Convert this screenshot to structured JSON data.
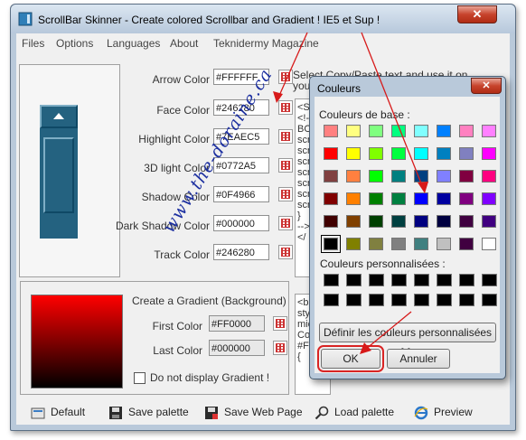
{
  "window": {
    "title": "ScrollBar Skinner - Create colored Scrollbar and Gradient ! IE5 et Sup !",
    "close_label": "✕"
  },
  "menu": [
    "Files",
    "Options",
    "Languages",
    "About",
    "Teknidermy Magazine"
  ],
  "colors": [
    {
      "label": "Arrow Color",
      "value": "#FFFFFF"
    },
    {
      "label": "Face Color",
      "value": "#246280"
    },
    {
      "label": "Highlight Color",
      "value": "#7EAEC5"
    },
    {
      "label": "3D light Color",
      "value": "#0772A5"
    },
    {
      "label": "Shadow Color",
      "value": "#0F4966"
    },
    {
      "label": "Dark Shadow Color",
      "value": "#000000"
    },
    {
      "label": "Track Color",
      "value": "#246280"
    }
  ],
  "info_text": [
    "Select Copy/Paste text and use it on",
    "you"
  ],
  "code_lines": [
    "<S",
    "<!-",
    "BO",
    "scr",
    "scr",
    "scr",
    "scr",
    "scr",
    "scr",
    "scr",
    "}",
    "-->",
    "</"
  ],
  "gradient": {
    "heading": "Create a Gradient (Background)",
    "first_label": "First Color",
    "first_value": "#FF0000",
    "last_label": "Last Color",
    "last_value": "#000000",
    "checkbox_label": "Do not display Gradient !",
    "code_lines": [
      "<bo",
      "sty",
      "mic",
      "Co",
      "#FF",
      "{"
    ]
  },
  "toolbar": {
    "default": "Default",
    "save_palette": "Save palette",
    "save_web": "Save Web Page",
    "load_palette": "Load palette",
    "preview": "Preview"
  },
  "dialog": {
    "title": "Couleurs",
    "close_label": "✕",
    "basic_label": "Couleurs de base :",
    "custom_label": "Couleurs personnalisées :",
    "define_button": "Définir les couleurs personnalisées >>",
    "ok": "OK",
    "cancel": "Annuler",
    "basic_colors": [
      "#ff8080",
      "#ffff80",
      "#80ff80",
      "#00ff80",
      "#80ffff",
      "#0080ff",
      "#ff80c0",
      "#ff80ff",
      "#ff0000",
      "#ffff00",
      "#80ff00",
      "#00ff40",
      "#00ffff",
      "#0080c0",
      "#8080c0",
      "#ff00ff",
      "#804040",
      "#ff8040",
      "#00ff00",
      "#008080",
      "#004080",
      "#8080ff",
      "#800040",
      "#ff0080",
      "#800000",
      "#ff8000",
      "#008000",
      "#008040",
      "#0000ff",
      "#0000a0",
      "#800080",
      "#8000ff",
      "#400000",
      "#804000",
      "#004000",
      "#004040",
      "#000080",
      "#000040",
      "#400040",
      "#400080",
      "#000000",
      "#808000",
      "#808040",
      "#808080",
      "#408080",
      "#c0c0c0",
      "#400040",
      "#ffffff"
    ],
    "selected_index": 40,
    "custom_colors": [
      "#000000",
      "#000000",
      "#000000",
      "#000000",
      "#000000",
      "#000000",
      "#000000",
      "#000000",
      "#000000",
      "#000000",
      "#000000",
      "#000000",
      "#000000",
      "#000000",
      "#000000",
      "#000000"
    ]
  },
  "watermark": "www.the-doraine.ca"
}
